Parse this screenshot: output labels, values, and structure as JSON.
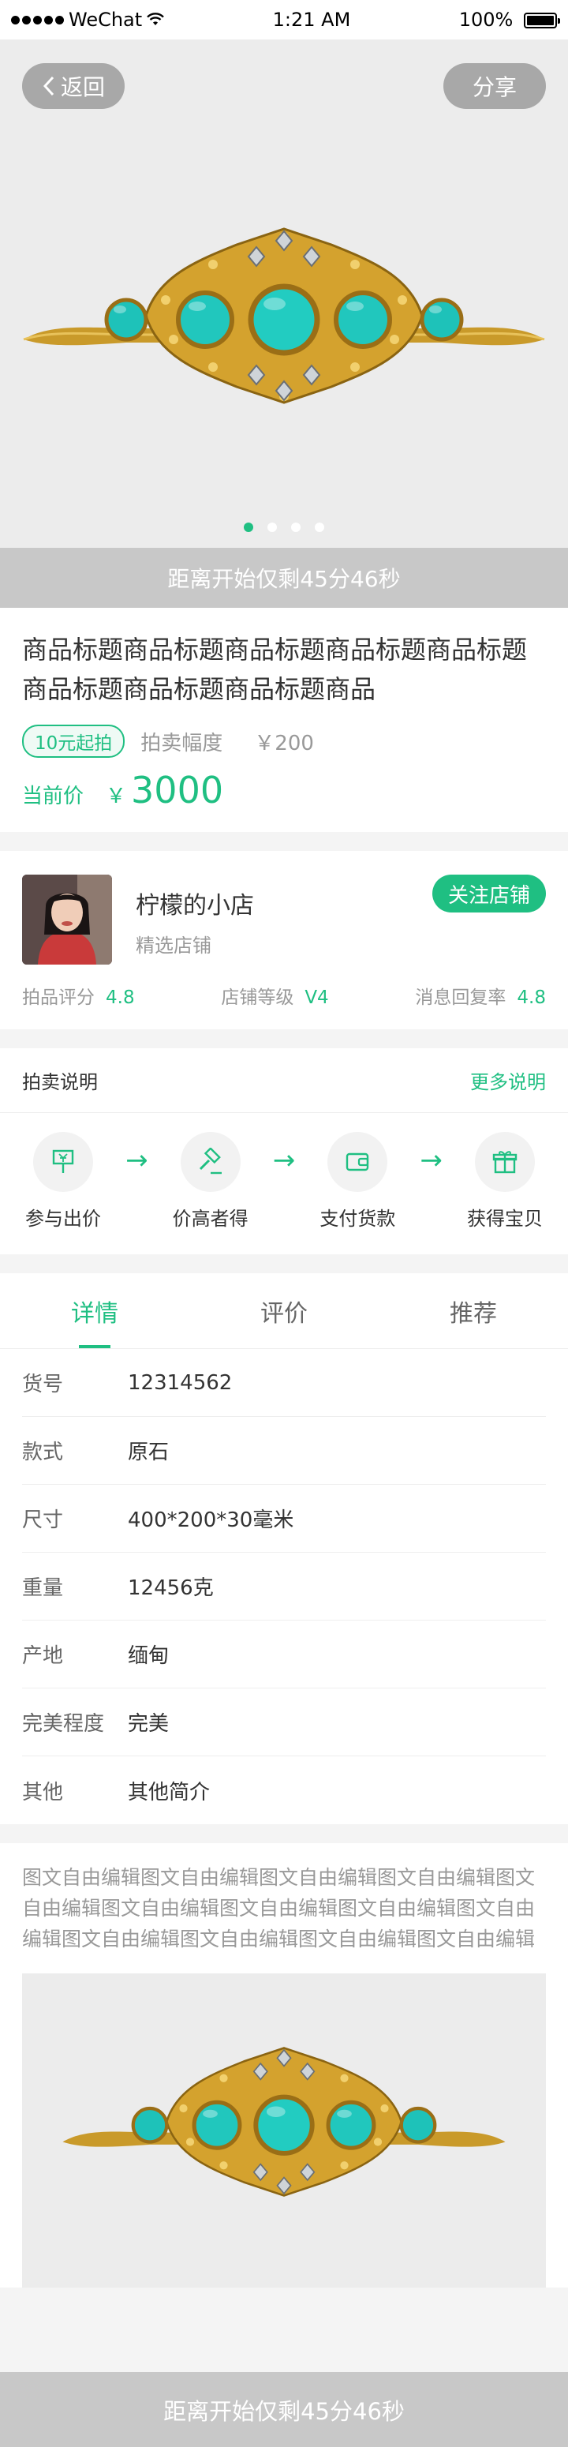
{
  "status_bar": {
    "carrier": "WeChat",
    "time": "1:21 AM",
    "battery": "100%"
  },
  "hero": {
    "back_label": "返回",
    "share_label": "分享",
    "slides_total": 4,
    "active_slide": 1
  },
  "countdown_text": "距离开始仅剩45分46秒",
  "product": {
    "title": "商品标题商品标题商品标题商品标题商品标题商品标题商品标题商品标题商品",
    "start_tag": "10元起拍",
    "increment_label": "拍卖幅度",
    "increment_value": "￥200",
    "current_price_label": "当前价",
    "currency": "￥",
    "current_price": "3000"
  },
  "shop": {
    "name": "柠檬的小店",
    "subtitle": "精选店铺",
    "follow_label": "关注店铺",
    "stats": [
      {
        "label": "拍品评分",
        "value": "4.8"
      },
      {
        "label": "店铺等级",
        "value": "V4"
      },
      {
        "label": "消息回复率",
        "value": "4.8"
      }
    ]
  },
  "auction": {
    "title": "拍卖说明",
    "more_label": "更多说明",
    "steps": [
      {
        "label": "参与出价",
        "icon": "bid-sign-icon"
      },
      {
        "label": "价高者得",
        "icon": "gavel-icon"
      },
      {
        "label": "支付货款",
        "icon": "wallet-icon"
      },
      {
        "label": "获得宝贝",
        "icon": "gift-icon"
      }
    ]
  },
  "tabs": [
    {
      "label": "详情",
      "active": true
    },
    {
      "label": "评价",
      "active": false
    },
    {
      "label": "推荐",
      "active": false
    }
  ],
  "specs": [
    {
      "key": "货号",
      "value": "12314562"
    },
    {
      "key": "款式",
      "value": "原石"
    },
    {
      "key": "尺寸",
      "value": "400*200*30毫米"
    },
    {
      "key": "重量",
      "value": "12456克"
    },
    {
      "key": "产地",
      "value": "缅甸"
    },
    {
      "key": "完美程度",
      "value": "完美"
    },
    {
      "key": "其他",
      "value": "其他简介"
    }
  ],
  "description": "图文自由编辑图文自由编辑图文自由编辑图文自由编辑图文自由编辑图文自由编辑图文自由编辑图文自由编辑图文自由编辑图文自由编辑图文自由编辑图文自由编辑图文自由编辑",
  "bottom_bar_text": "距离开始仅剩45分46秒",
  "colors": {
    "accent": "#1fbf82",
    "overlay_gray": "#c8c8c8"
  }
}
